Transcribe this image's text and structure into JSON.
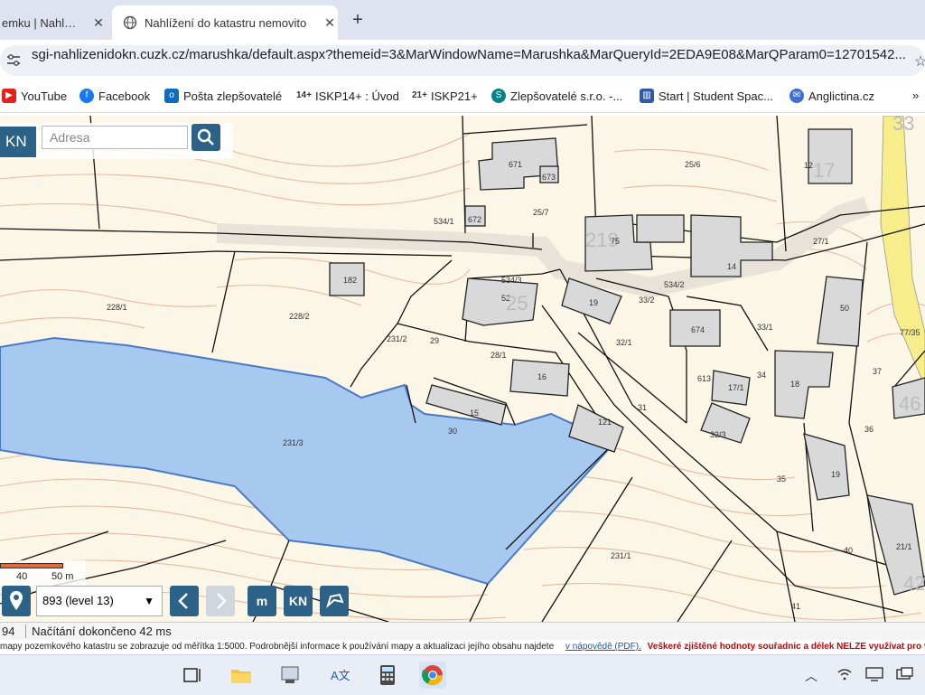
{
  "tabs": [
    {
      "label": "emku | Nahl…",
      "close": "✕"
    },
    {
      "label": "Nahlížení do katastru nemovito",
      "close": "✕"
    }
  ],
  "new_tab": "+",
  "address": {
    "url": "sgi-nahlizenidokn.cuzk.cz/marushka/default.aspx?themeid=3&MarWindowName=Marushka&MarQueryId=2EDA9E08&MarQParam0=12701542..."
  },
  "bookmarks": [
    "YouTube",
    "Facebook",
    "Pošta zlepšovatelé",
    "ISKP14+ : Úvod",
    "ISKP21+",
    "Zlepšovatelé s.r.o. -...",
    "Start | Student Spac...",
    "Anglictina.cz",
    "»"
  ],
  "map": {
    "kn_label": "KN",
    "search_placeholder": "Adresa",
    "scale": {
      "mid": "40",
      "end": "50 m"
    },
    "level": "893 (level 13)",
    "buttons": {
      "m": "m",
      "kn": "KN"
    },
    "parcels": [
      "671",
      "673",
      "25/6",
      "25/7",
      "672",
      "534/1",
      "219",
      "75",
      "14",
      "27/1",
      "12",
      "17",
      "228/1",
      "182",
      "228/2",
      "534/3",
      "52",
      "25",
      "534/2",
      "19",
      "33/2",
      "674",
      "33/1",
      "50",
      "29",
      "231/2",
      "32/1",
      "28/1",
      "16",
      "613",
      "34",
      "18",
      "37",
      "231/3",
      "15",
      "30",
      "121",
      "17/1",
      "32/3",
      "36",
      "35",
      "19",
      "231/1",
      "40",
      "21/1",
      "41",
      "31",
      "33",
      "77/35",
      "46",
      "42"
    ],
    "colors": {
      "parcel_fill": "#fbf6e6",
      "building": "#d9d9d9",
      "highlight": "#a8c9ef",
      "highlight_stroke": "#4a79c8",
      "contour": "#e9b89e",
      "ui_blue": "#2c6288"
    }
  },
  "status": {
    "left": "94",
    "text": "Načítání dokončeno 42 ms"
  },
  "notice": {
    "part1": "mapy pozemkového katastru se zobrazuje od měřítka 1:5000. Podrobnější informace k používání mapy a aktualizaci jejího obsahu najdete",
    "link": "v nápovědě (PDF).",
    "warning": "Veškeré zjištěné hodnoty souřadnic a délek NELZE využívat pro vytyčování"
  }
}
